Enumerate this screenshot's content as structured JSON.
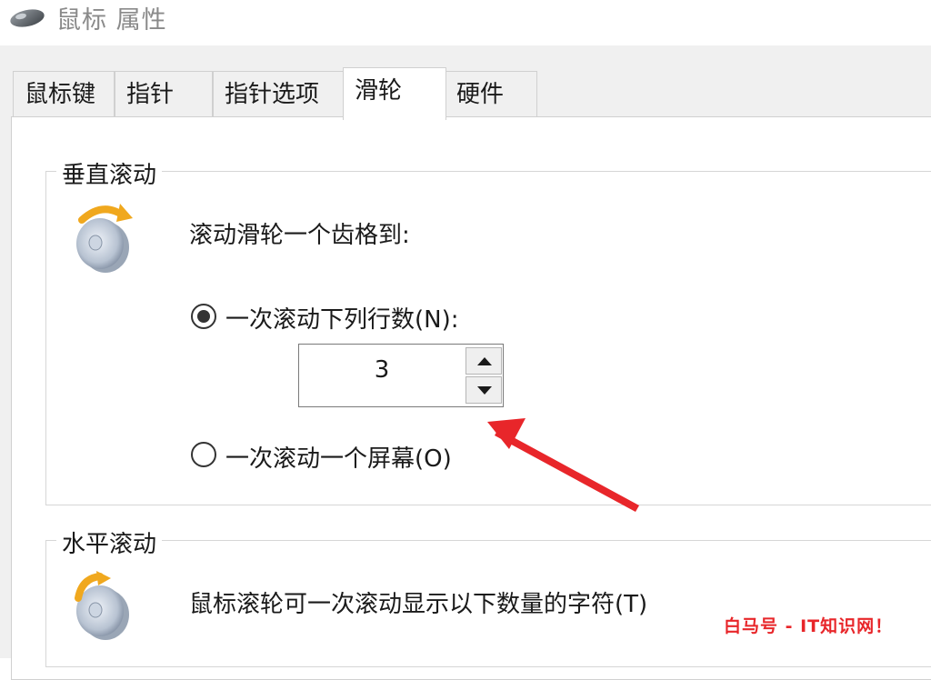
{
  "window": {
    "title": "鼠标 属性",
    "icon": "mouse-icon"
  },
  "tabs": [
    {
      "label": "鼠标键"
    },
    {
      "label": "指针"
    },
    {
      "label": "指针选项"
    },
    {
      "label": "滑轮",
      "active": true
    },
    {
      "label": "硬件"
    }
  ],
  "vertical_scroll": {
    "group_title": "垂直滚动",
    "icon": "scroll-wheel-vertical-icon",
    "prompt": "滚动滑轮一个齿格到:",
    "option_lines": {
      "label": "一次滚动下列行数(N):",
      "selected": true
    },
    "lines_value": "3",
    "option_screen": {
      "label": "一次滚动一个屏幕(O)",
      "selected": false
    }
  },
  "horizontal_scroll": {
    "group_title": "水平滚动",
    "icon": "scroll-wheel-horizontal-icon",
    "prompt": "鼠标滚轮可一次滚动显示以下数量的字符(T)"
  },
  "watermark": "白马号 - IT知识网！",
  "colors": {
    "accent_arrow": "#e8262a",
    "dialog_bg": "#f0f0f0",
    "panel_bg": "#ffffff"
  }
}
